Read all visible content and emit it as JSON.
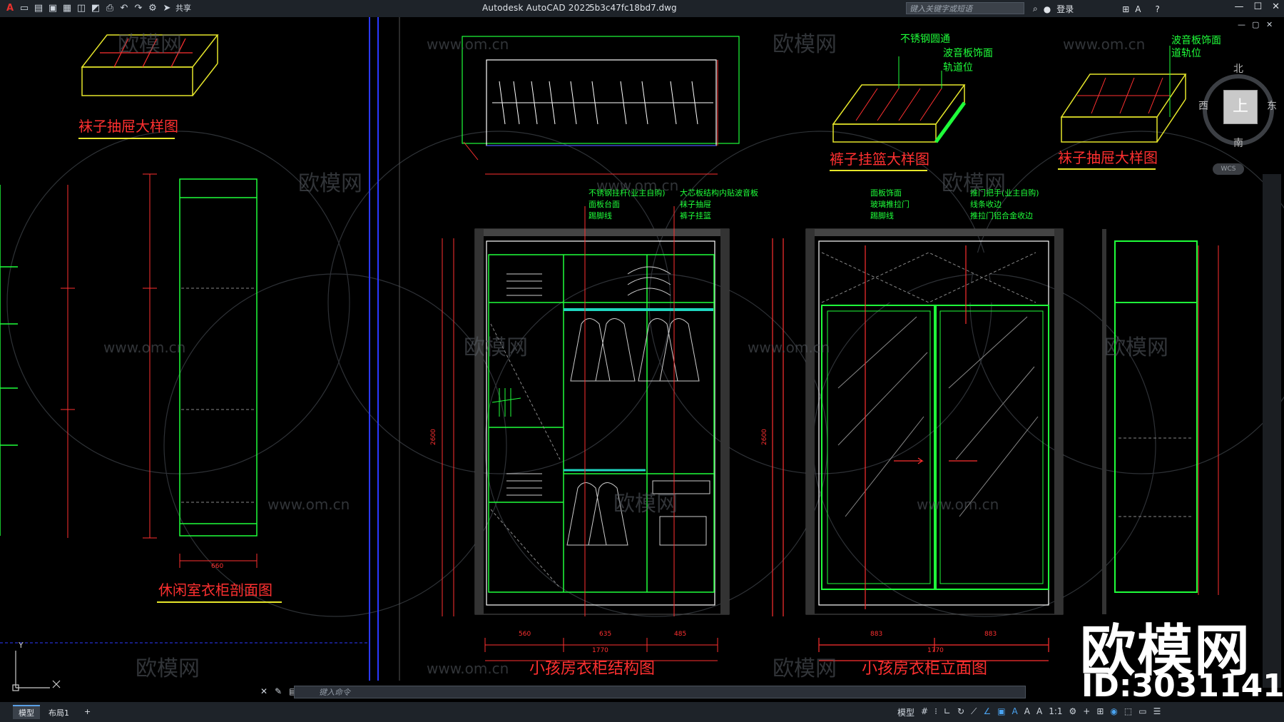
{
  "app": {
    "title": "Autodesk AutoCAD 2022",
    "file": "5b3c47fc18bd7.dwg",
    "share_label": "共享",
    "search_placeholder": "键入关键字或短语",
    "login_label": "登录"
  },
  "command": {
    "placeholder": "键入命令"
  },
  "layout_tabs": [
    "模型",
    "布局1"
  ],
  "status": {
    "model_label": "模型",
    "scale": "1:1"
  },
  "navcube": {
    "north": "北",
    "south": "南",
    "east": "东",
    "west": "西",
    "face": "上",
    "wcs": "WCS"
  },
  "watermark": {
    "url": "www.om.cn",
    "name": "欧模网"
  },
  "brand": {
    "name": "欧模网",
    "id": "ID:3031141"
  },
  "drawing": {
    "titles": {
      "sock_drawer_left": "袜子抽屉大样图",
      "leisure_section": "休闲室衣柜剖面图",
      "kids_structure": "小孩房衣柜结构图",
      "pants_basket": "裤子挂篮大样图",
      "sock_drawer_right": "袜子抽屉大样图",
      "kids_elevation": "小孩房衣柜立面图"
    },
    "annotations": {
      "pants_basket": [
        "不锈钢圆通",
        "波音板饰面",
        "轨道位"
      ],
      "sock_drawer_right": [
        "波音板饰面",
        "道轨位"
      ],
      "structure_left": [
        "不锈钢挂杆(业主自购)",
        "面板台面",
        "踢脚线"
      ],
      "structure_right": [
        "大芯板结构内贴波音板",
        "袜子抽屉",
        "裤子挂篮"
      ],
      "elevation_left": [
        "面板饰面",
        "玻璃推拉门",
        "踢脚线"
      ],
      "elevation_right": [
        "推门把手(业主自购)",
        "线条收边",
        "推拉门铝合金收边"
      ]
    },
    "dimensions": {
      "leisure_width": "660",
      "structure_widths": [
        "560",
        "635",
        "485"
      ],
      "structure_total": "1770",
      "elevation_widths": [
        "883",
        "883"
      ],
      "elevation_total": "1770",
      "structure_height": "2600",
      "elevation_height": "2600"
    }
  }
}
